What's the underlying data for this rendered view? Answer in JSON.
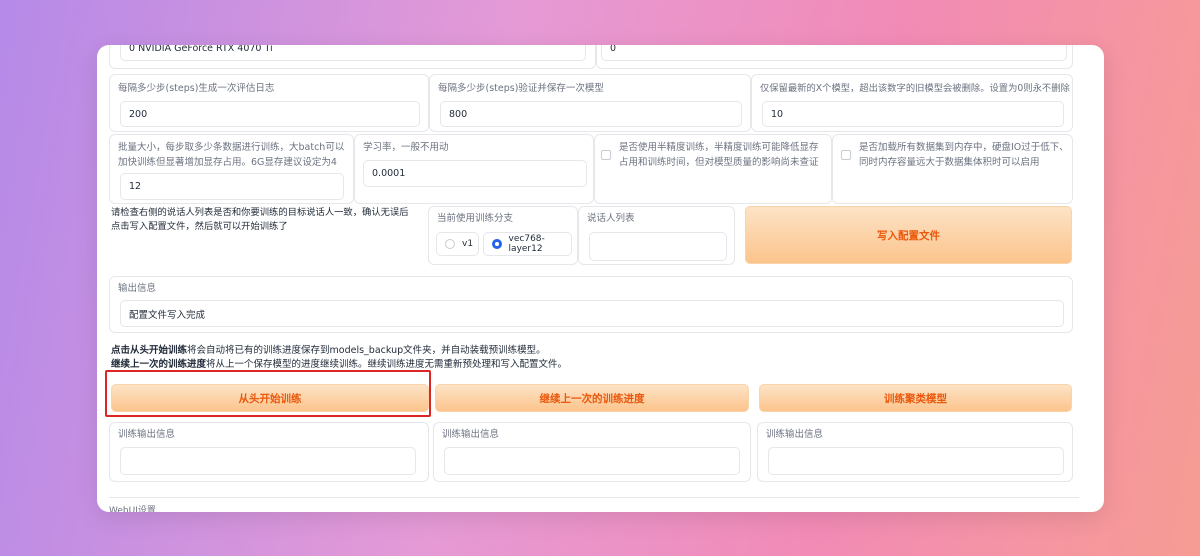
{
  "top_row": {
    "gpu_value": "0 NVIDIA GeForce RTX 4070 Ti",
    "right_value": "0"
  },
  "row_steps": {
    "eval_label": "每隔多少步(steps)生成一次评估日志",
    "eval_value": "200",
    "save_label": "每隔多少步(steps)验证并保存一次模型",
    "save_value": "800",
    "keep_label": "仅保留最新的X个模型，超出该数字的旧模型会被删除。设置为0则永不删除",
    "keep_value": "10"
  },
  "row_batch": {
    "batch_label": "批量大小，每步取多少条数据进行训练，大batch可以加快训练但显著增加显存占用。6G显存建议设定为4",
    "batch_value": "12",
    "lr_label": "学习率，一般不用动",
    "lr_value": "0.0001",
    "half_label": "是否使用半精度训练，半精度训练可能降低显存占用和训练时间，但对模型质量的影响尚未查证",
    "load_label": "是否加载所有数据集到内存中，硬盘IO过于低下、同时内存容量远大于数据集体积时可以启用"
  },
  "row_config": {
    "hint": "请检查右侧的说话人列表是否和你要训练的目标说话人一致，确认无误后点击写入配置文件，然后就可以开始训练了",
    "branch_label": "当前使用训练分支",
    "branch_options": [
      "v1",
      "vec768-layer12"
    ],
    "branch_selected": "vec768-layer12",
    "speakers_label": "说话人列表",
    "write_button": "写入配置文件"
  },
  "output": {
    "label": "输出信息",
    "value": "配置文件写入完成"
  },
  "notes": {
    "line1_bold": "点击从头开始训练",
    "line1_rest": "将会自动将已有的训练进度保存到models_backup文件夹，并自动装载预训练模型。",
    "line2_bold": "继续上一次的训练进度",
    "line2_rest": "将从上一个保存模型的进度继续训练。继续训练进度无需重新预处理和写入配置文件。"
  },
  "actions": {
    "start_button": "从头开始训练",
    "continue_button": "继续上一次的训练进度",
    "cluster_button": "训练聚类模型",
    "output_label_1": "训练输出信息",
    "output_label_2": "训练输出信息",
    "output_label_3": "训练输出信息"
  },
  "footer": {
    "webui_settings": "WebUI设置"
  },
  "colors": {
    "accent": "#ea580c",
    "button_bg": "#fbc48c",
    "radio_selected": "#2563eb",
    "highlight": "#dc2626"
  }
}
